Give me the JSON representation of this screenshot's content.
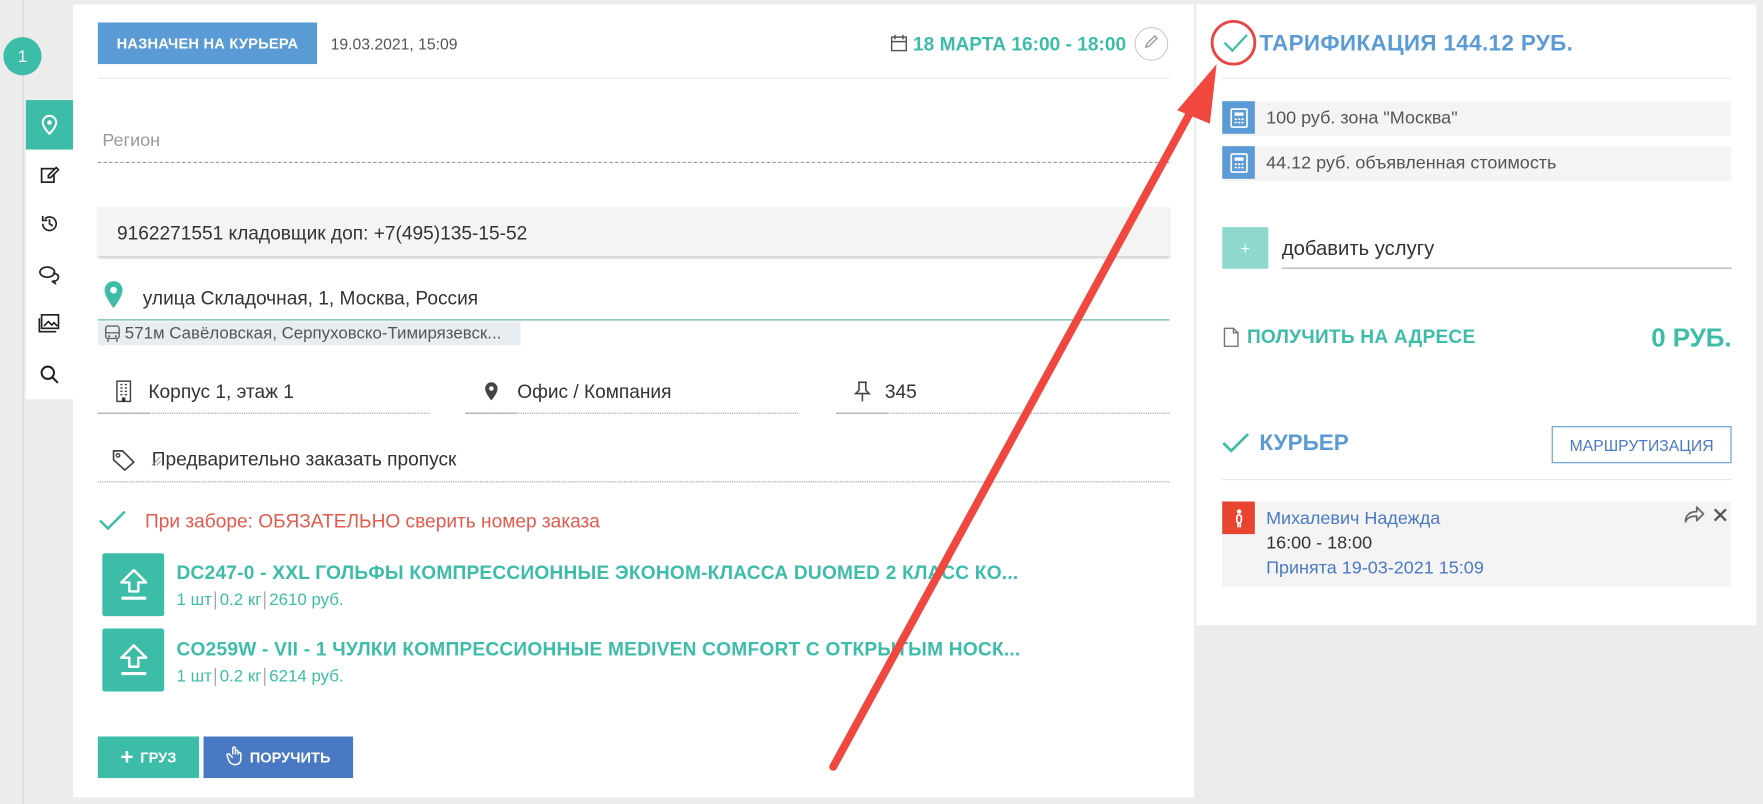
{
  "steps": {
    "current": "1"
  },
  "toolbar": {
    "items": [
      {
        "icon": "map-pin-icon",
        "active": true
      },
      {
        "icon": "edit-icon",
        "active": false
      },
      {
        "icon": "history-icon",
        "active": false
      },
      {
        "icon": "comments-icon",
        "active": false
      },
      {
        "icon": "gallery-icon",
        "active": false
      },
      {
        "icon": "search-icon",
        "active": false
      }
    ]
  },
  "order": {
    "status_badge": "НАЗНАЧЕН НА КУРЬЕРА",
    "status_date": "19.03.2021, 15:09",
    "delivery_slot": "18 МАРТА 16:00 - 18:00",
    "region_placeholder": "Регион",
    "phone": "9162271551 кладовщик доп: +7(495)135-15-52",
    "address": "улица Складочная, 1, Москва, Россия",
    "metro": "571м Савёловская, Серпуховско-Тимирязевск...",
    "building": "Корпус 1, этаж 1",
    "office": "Офис / Компания",
    "apartment": "345",
    "note": "Предварительно заказать пропуск",
    "warning": "При заборе: ОБЯЗАТЕЛЬНО сверить номер заказа"
  },
  "items": [
    {
      "title": "DC247-0 - XXL ГОЛЬФЫ КОМПРЕССИОННЫЕ ЭКОНОМ-КЛАССА DUOMED 2 КЛАСС КО...",
      "qty": "1 шт",
      "weight": "0.2 кг",
      "price": "2610 руб."
    },
    {
      "title": "CO259W - VII - 1 ЧУЛКИ КОМПРЕССИОННЫЕ MEDIVEN COMFORT С ОТКРЫТЫМ НОСК...",
      "qty": "1 шт",
      "weight": "0.2 кг",
      "price": "6214 руб."
    }
  ],
  "actions": {
    "cargo": "ГРУЗ",
    "assign": "ПОРУЧИТЬ"
  },
  "tariff": {
    "title": "ТАРИФИКАЦИЯ 144.12 РУБ.",
    "rows": [
      {
        "text": "100 руб. зона \"Москва\""
      },
      {
        "text": "44.12 руб. объявленная стоимость"
      }
    ],
    "add_button": "+",
    "add_service": "добавить услугу",
    "receive_label": "ПОЛУЧИТЬ НА АДРЕСЕ",
    "receive_amount": "0 РУБ."
  },
  "courier": {
    "title": "КУРЬЕР",
    "route_button": "МАРШРУТИЗАЦИЯ",
    "name": "Михалевич Надежда",
    "time": "16:00 - 18:00",
    "accepted": "Принята 19-03-2021 15:09"
  },
  "colors": {
    "teal": "#3dbda8",
    "blue": "#5b9bd5",
    "red_annotation": "#e8442f"
  }
}
